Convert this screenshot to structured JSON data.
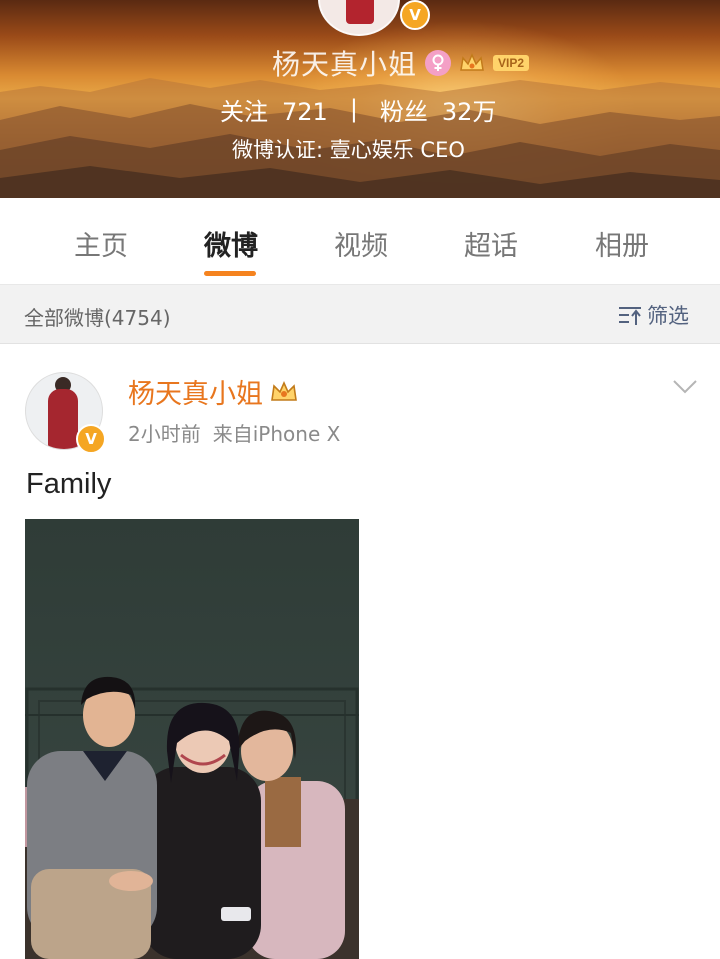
{
  "profile": {
    "nickname": "杨天真小姐",
    "vip_label": "VIP2",
    "verified_mark": "V",
    "following_label": "关注",
    "following_count": "721",
    "separator": "|",
    "followers_label": "粉丝",
    "followers_count": "32万",
    "certification": "微博认证: 壹心娱乐 CEO",
    "icons": [
      "verified-icon",
      "female-icon",
      "crown-icon"
    ]
  },
  "tabs": [
    {
      "label": "主页",
      "active": false
    },
    {
      "label": "微博",
      "active": true
    },
    {
      "label": "视频",
      "active": false
    },
    {
      "label": "超话",
      "active": false
    },
    {
      "label": "相册",
      "active": false
    }
  ],
  "filter_bar": {
    "all_posts": "全部微博(4754)",
    "filter_label": "筛选"
  },
  "post": {
    "author": "杨天真小姐",
    "time": "2小时前",
    "source": "来自iPhone X",
    "text": "Family",
    "image": "photo of four people seated indoors"
  },
  "colors": {
    "accent_orange": "#f5831f",
    "author_orange": "#e8761e",
    "verified_gold": "#f5a623",
    "filter_blue": "#53627f"
  }
}
